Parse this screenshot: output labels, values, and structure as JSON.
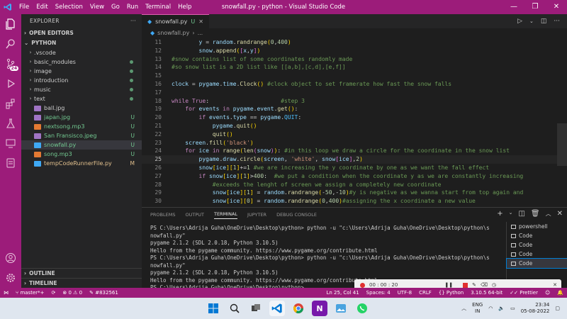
{
  "window": {
    "title": "snowfall.py - python - Visual Studio Code",
    "menu": [
      "File",
      "Edit",
      "Selection",
      "View",
      "Go",
      "Run",
      "Terminal",
      "Help"
    ]
  },
  "activity_bar": {
    "source_control_badge": "24"
  },
  "explorer": {
    "header": "EXPLORER",
    "open_editors": "OPEN EDITORS",
    "folder": "PYTHON",
    "items": [
      {
        "label": ".vscode",
        "type": "folder",
        "status": ""
      },
      {
        "label": "basic_modules",
        "type": "folder",
        "status": "dot"
      },
      {
        "label": "image",
        "type": "folder",
        "status": "dot"
      },
      {
        "label": "introduction",
        "type": "folder",
        "status": "dot"
      },
      {
        "label": "music",
        "type": "folder",
        "status": "dot"
      },
      {
        "label": "text",
        "type": "folder",
        "status": "dot"
      },
      {
        "label": "ball.jpg",
        "type": "jpg",
        "status": ""
      },
      {
        "label": "japan.jpg",
        "type": "jpg",
        "status": "U"
      },
      {
        "label": "nextsong.mp3",
        "type": "mp3",
        "status": "U"
      },
      {
        "label": "San Fransisco.jpeg",
        "type": "jpg",
        "status": "U"
      },
      {
        "label": "snowfall.py",
        "type": "py",
        "status": "U"
      },
      {
        "label": "song.mp3",
        "type": "mp3",
        "status": "U"
      },
      {
        "label": "tempCodeRunnerFile.py",
        "type": "py",
        "status": "M"
      }
    ],
    "outline": "OUTLINE",
    "timeline": "TIMELINE"
  },
  "editor": {
    "tab_label": "snowfall.py",
    "tab_status": "U",
    "breadcrumb": "snowfall.py",
    "current_line": 25,
    "lines": [
      {
        "n": 11,
        "code": "        y = random.randrange(0,400)"
      },
      {
        "n": 12,
        "code": "        snow.append([x,y])"
      },
      {
        "n": 13,
        "code": "#snow contains list of some coordinates randomly made"
      },
      {
        "n": 14,
        "code": "#so snow list is a 2D list like [[a,b],[c,d],[e,f]]"
      },
      {
        "n": 15,
        "code": ""
      },
      {
        "n": 16,
        "code": "clock = pygame.time.Clock() #clock object to set framerate how fast the snow falls"
      },
      {
        "n": 17,
        "code": ""
      },
      {
        "n": 18,
        "code": "while True:                     #step 3"
      },
      {
        "n": 19,
        "code": "    for events in pygame.event.get():"
      },
      {
        "n": 20,
        "code": "        if events.type == pygame.QUIT:"
      },
      {
        "n": 21,
        "code": "            pygame.quit()"
      },
      {
        "n": 22,
        "code": "            quit()"
      },
      {
        "n": 23,
        "code": "    screen.fill('black')"
      },
      {
        "n": 24,
        "code": "    for ice in range(len(snow)): #in this loop we draw a circle for the coordinate in the snow list"
      },
      {
        "n": 25,
        "code": "        pygame.draw.circle(screen, 'white', snow[ice],2)"
      },
      {
        "n": 26,
        "code": "        snow[ice][1]+=1 #we are increasing the y coordinate by one as we want the fall effect"
      },
      {
        "n": 27,
        "code": "        if snow[ice][1]>400:  #we put a condition when the coordinate y as we are constantly increasing"
      },
      {
        "n": 28,
        "code": "            #exceeds the lenght of screen we assign a completely new coordinate"
      },
      {
        "n": 29,
        "code": "            snow[ice][1] = random.randrange(-50,-10)#y is negative as we wanna start from top again and"
      },
      {
        "n": 30,
        "code": "            snow[ice][0] = random.randrange(0,400)#assigning the x coordinate a new value"
      }
    ]
  },
  "panel": {
    "tabs": [
      "PROBLEMS",
      "OUTPUT",
      "TERMINAL",
      "JUPYTER",
      "DEBUG CONSOLE"
    ],
    "active_tab": "TERMINAL",
    "terminal_lines": [
      "PS C:\\Users\\Adrija Guha\\OneDrive\\Desktop\\python> python -u \"c:\\Users\\Adrija Guha\\OneDrive\\Desktop\\python\\s",
      "nowfall.py\"",
      "pygame 2.1.2 (SDL 2.0.18, Python 3.10.5)",
      "Hello from the pygame community. https://www.pygame.org/contribute.html",
      "PS C:\\Users\\Adrija Guha\\OneDrive\\Desktop\\python> python -u \"c:\\Users\\Adrija Guha\\OneDrive\\Desktop\\python\\s",
      "nowfall.py\"",
      "pygame 2.1.2 (SDL 2.0.18, Python 3.10.5)",
      "Hello from the pygame community. https://www.pygame.org/contribute.html",
      "PS C:\\Users\\Adrija Guha\\OneDrive\\Desktop\\python> "
    ],
    "terminals": [
      {
        "label": "powershell",
        "selected": false
      },
      {
        "label": "Code",
        "selected": false
      },
      {
        "label": "Code",
        "selected": false
      },
      {
        "label": "Code",
        "selected": false
      },
      {
        "label": "Code",
        "selected": true
      }
    ]
  },
  "recorder": {
    "time": "00 : 00 : 20"
  },
  "statusbar": {
    "branch": "master*+",
    "sync": "⟳",
    "errors": "0",
    "warnings": "0",
    "color_code": "#832561",
    "position": "Ln 25, Col 41",
    "spaces": "Spaces: 4",
    "encoding": "UTF-8",
    "eol": "CRLF",
    "language": "Python",
    "interpreter": "3.10.5 64-bit",
    "formatter": "Prettier"
  },
  "taskbar": {
    "lang_top": "ENG",
    "lang_bottom": "IN",
    "time": "23:34",
    "date": "05-08-2022"
  },
  "colors": {
    "accent": "#9c1c7a",
    "untracked": "#73c991",
    "modified": "#e2c08d"
  }
}
